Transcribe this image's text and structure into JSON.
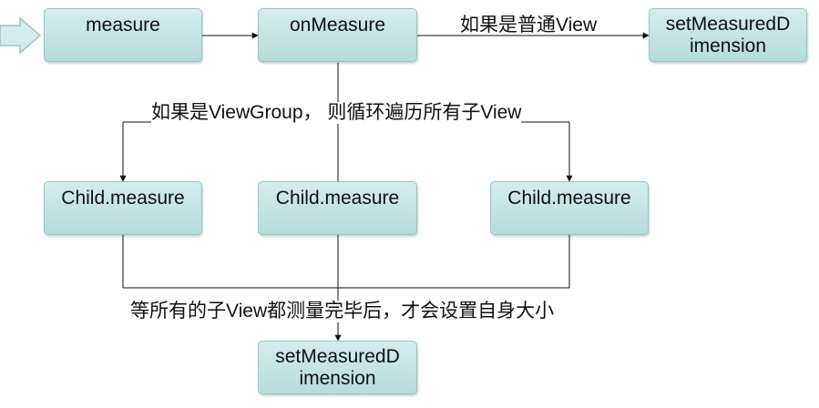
{
  "nodes": {
    "measure": "measure",
    "on_measure": "onMeasure",
    "set_measured_dimension_top": [
      "setMeasuredD",
      "imension"
    ],
    "child_1": "Child.measure",
    "child_2": "Child.measure",
    "child_3": "Child.measure",
    "set_measured_dimension_bottom": [
      "setMeasuredD",
      "imension"
    ]
  },
  "labels": {
    "normal_view": "如果是普通View",
    "view_group": "如果是ViewGroup， 则循环遍历所有子View",
    "after_children": "等所有的子View都测量完毕后，才会设置自身大小"
  },
  "colors": {
    "box_fill_top": "#d6ecec",
    "box_fill_bottom": "#b5dcdc",
    "box_border": "#93c5c5",
    "line": "#111111"
  }
}
